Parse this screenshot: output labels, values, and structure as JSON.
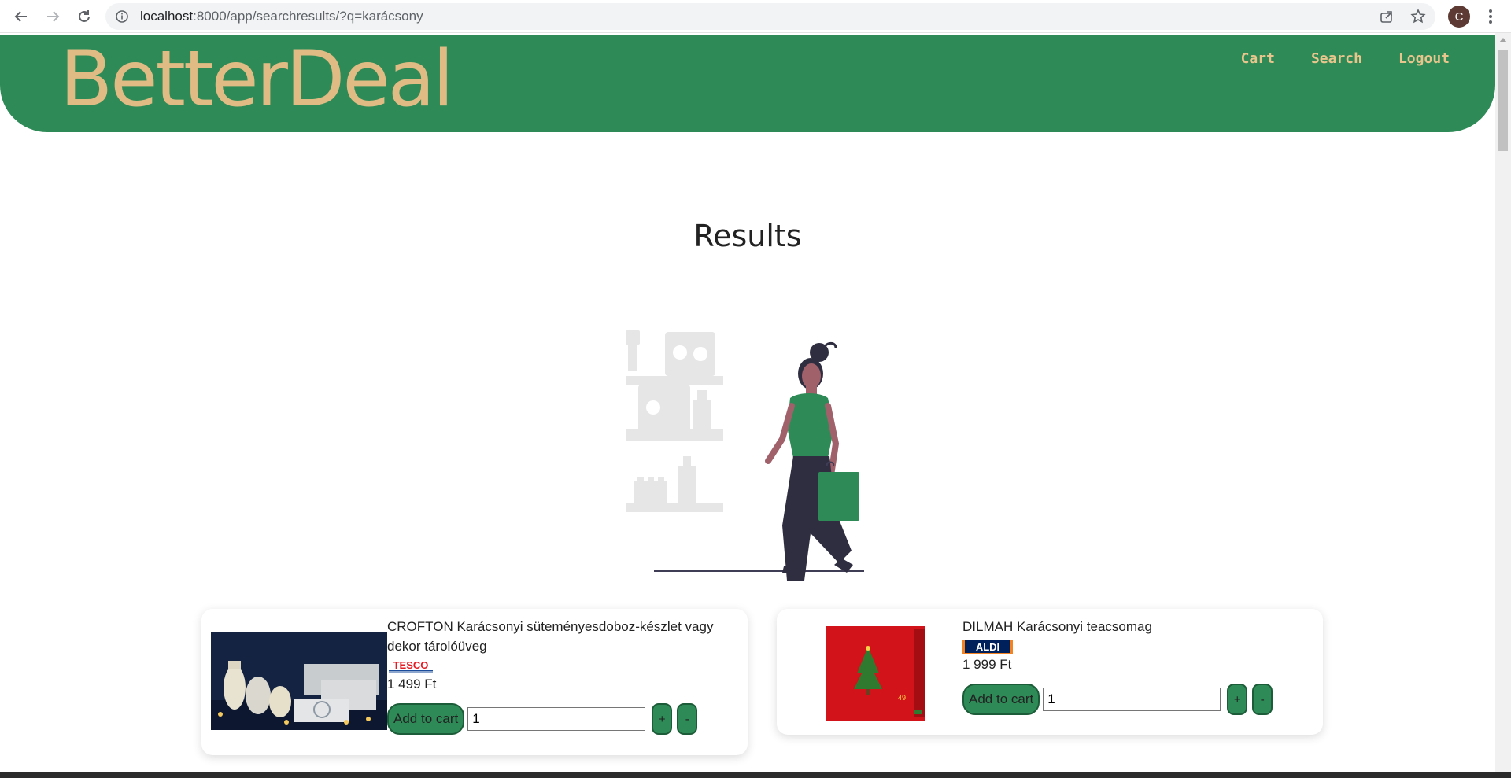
{
  "browser": {
    "url_host": "localhost",
    "url_path": ":8000/app/searchresults/?q=karácsony",
    "avatar_letter": "C"
  },
  "header": {
    "logo": "BetterDeal",
    "nav": [
      "Cart",
      "Search",
      "Logout"
    ],
    "bg_color": "#2e8b57",
    "accent_color": "#e0bb83"
  },
  "page": {
    "title": "Results"
  },
  "products": [
    {
      "name": "CROFTON Karácsonyi süteményesdoboz-készlet vagy dekor tárolóüveg",
      "store": "TESCO",
      "price": "1 499 Ft",
      "add_label": "Add to cart",
      "qty": "1",
      "plus": "+",
      "minus": "-"
    },
    {
      "name": "DILMAH Karácsonyi teacsomag",
      "store": "ALDI",
      "price": "1 999 Ft",
      "add_label": "Add to cart",
      "qty": "1",
      "plus": "+",
      "minus": "-"
    }
  ]
}
